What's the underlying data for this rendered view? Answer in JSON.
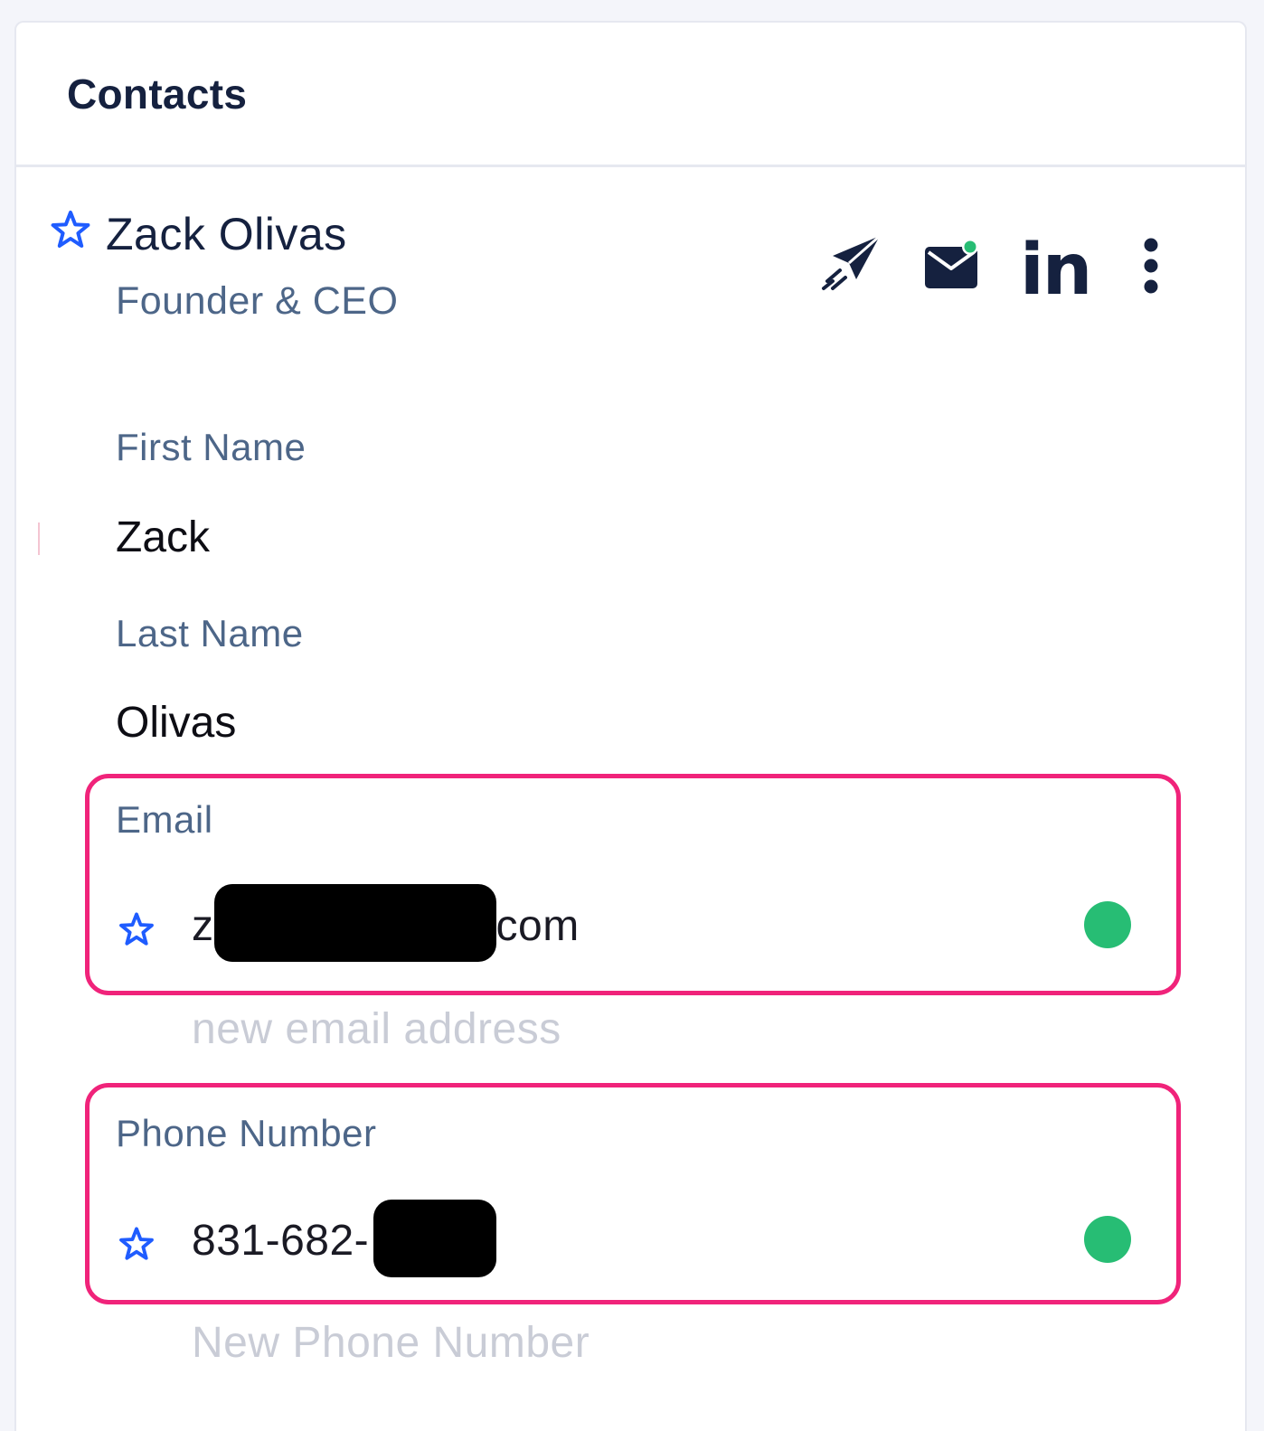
{
  "panel": {
    "title": "Contacts"
  },
  "contact": {
    "name": "Zack Olivas",
    "job_title": "Founder & CEO",
    "actions": [
      {
        "icon": "send-icon"
      },
      {
        "icon": "mail-icon",
        "badge_color": "#27bd74"
      },
      {
        "icon": "linkedin-icon",
        "text": "in"
      },
      {
        "icon": "more-vertical-icon"
      }
    ]
  },
  "fields": {
    "first_name": {
      "label": "First Name",
      "value": "Zack"
    },
    "last_name": {
      "label": "Last Name",
      "value": "Olivas"
    },
    "email": {
      "label": "Email",
      "value_prefix": "z",
      "value_suffix": "com",
      "placeholder": "new email address",
      "status_color": "#27bd74"
    },
    "phone": {
      "label": "Phone Number",
      "value_prefix": "831-682-",
      "placeholder": "New Phone Number",
      "status_color": "#27bd74"
    }
  },
  "colors": {
    "accent_star": "#1f5cff",
    "highlight": "#f0237a",
    "navy": "#15213f"
  }
}
